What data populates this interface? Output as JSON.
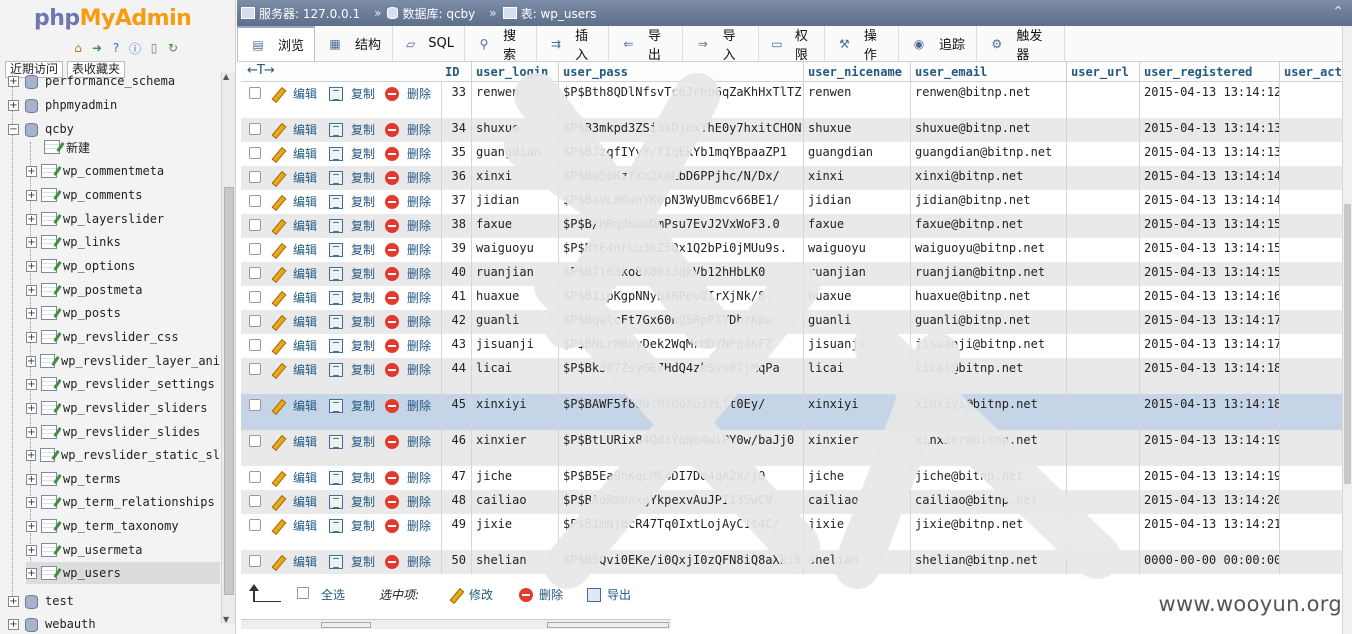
{
  "logo": {
    "part1": "php",
    "part2": "MyAdmin"
  },
  "nav": {
    "icons": [
      "home-icon",
      "exit-icon",
      "help-icon",
      "docs-icon",
      "settings-icon",
      "reload-icon"
    ],
    "tabs": [
      "近期访问",
      "表收藏夹"
    ],
    "tree": [
      {
        "label": "performance_schema",
        "type": "db",
        "expander": "+"
      },
      {
        "label": "phpmyadmin",
        "type": "db",
        "expander": "+"
      },
      {
        "label": "qcby",
        "type": "db",
        "expander": "−"
      },
      {
        "label": "新建",
        "type": "new",
        "expander": ""
      },
      {
        "label": "wp_commentmeta",
        "type": "table",
        "expander": "+"
      },
      {
        "label": "wp_comments",
        "type": "table",
        "expander": "+"
      },
      {
        "label": "wp_layerslider",
        "type": "table",
        "expander": "+"
      },
      {
        "label": "wp_links",
        "type": "table",
        "expander": "+"
      },
      {
        "label": "wp_options",
        "type": "table",
        "expander": "+"
      },
      {
        "label": "wp_postmeta",
        "type": "table",
        "expander": "+"
      },
      {
        "label": "wp_posts",
        "type": "table",
        "expander": "+"
      },
      {
        "label": "wp_revslider_css",
        "type": "table",
        "expander": "+"
      },
      {
        "label": "wp_revslider_layer_ani",
        "type": "table",
        "expander": "+"
      },
      {
        "label": "wp_revslider_settings",
        "type": "table",
        "expander": "+"
      },
      {
        "label": "wp_revslider_sliders",
        "type": "table",
        "expander": "+"
      },
      {
        "label": "wp_revslider_slides",
        "type": "table",
        "expander": "+"
      },
      {
        "label": "wp_revslider_static_sl",
        "type": "table",
        "expander": "+"
      },
      {
        "label": "wp_terms",
        "type": "table",
        "expander": "+"
      },
      {
        "label": "wp_term_relationships",
        "type": "table",
        "expander": "+"
      },
      {
        "label": "wp_term_taxonomy",
        "type": "table",
        "expander": "+"
      },
      {
        "label": "wp_usermeta",
        "type": "table",
        "expander": "+"
      },
      {
        "label": "wp_users",
        "type": "table",
        "expander": "+",
        "highlight": true
      },
      {
        "label": "test",
        "type": "db",
        "expander": "+"
      },
      {
        "label": "webauth",
        "type": "db",
        "expander": "+"
      }
    ]
  },
  "breadcrumb": {
    "server": "服务器: 127.0.0.1",
    "database": "数据库: qcby",
    "table": "表: wp_users"
  },
  "tabs": [
    {
      "label": "浏览",
      "icon": "browse-icon",
      "active": true
    },
    {
      "label": "结构",
      "icon": "structure-icon"
    },
    {
      "label": "SQL",
      "icon": "sql-icon"
    },
    {
      "label": "搜索",
      "icon": "search-icon"
    },
    {
      "label": "插入",
      "icon": "insert-icon"
    },
    {
      "label": "导出",
      "icon": "export-icon"
    },
    {
      "label": "导入",
      "icon": "import-icon"
    },
    {
      "label": "权限",
      "icon": "privileges-icon"
    },
    {
      "label": "操作",
      "icon": "operations-icon"
    },
    {
      "label": "追踪",
      "icon": "tracking-icon"
    },
    {
      "label": "触发器",
      "icon": "triggers-icon"
    }
  ],
  "grid": {
    "arrows": "←T→",
    "columns": [
      "ID",
      "user_login",
      "user_pass",
      "user_nicename",
      "user_email",
      "user_url",
      "user_registered",
      "user_acti"
    ],
    "actions": {
      "edit": "编辑",
      "copy": "复制",
      "delete": "删除"
    },
    "rows": [
      {
        "id": "33",
        "login": "renwen",
        "pass": "$P$Bth8QDlNfsvTc6Jrhp6qZaKhHxTlTZ1",
        "nicename": "renwen",
        "email": "renwen@bitnp.net",
        "url": "",
        "registered": "2015-04-13 13:14:12"
      },
      {
        "id": "34",
        "login": "shuxue",
        "pass": "$P$B3mkpd3ZSi3kDjoxYhE0y7hxitCHON1",
        "nicename": "shuxue",
        "email": "shuxue@bitnp.net",
        "url": "",
        "registered": "2015-04-13 13:14:13"
      },
      {
        "id": "35",
        "login": "guangdian",
        "pass": "$P$BJzqfIYyY/fIqEkYb1mqYBpaaZP1",
        "nicename": "guangdian",
        "email": "guangdian@bitnp.net",
        "url": "",
        "registered": "2015-04-13 13:14:13"
      },
      {
        "id": "36",
        "login": "xinxi",
        "pass": "$P$Bw5pKzfXn2XmLbD6PPjhc/N/Dx/",
        "nicename": "xinxi",
        "email": "xinxi@bitnp.net",
        "url": "",
        "registered": "2015-04-13 13:14:14"
      },
      {
        "id": "37",
        "login": "jidian",
        "pass": "$P$BaVLmKwnYK0pN3WyUBmcv66BE1/",
        "nicename": "jidian",
        "email": "jidian@bitnp.net",
        "url": "",
        "registered": "2015-04-13 13:14:14"
      },
      {
        "id": "38",
        "login": "faxue",
        "pass": "$P$B/HRqdxwaDmPsu7EvJ2VxWoF3.0",
        "nicename": "faxue",
        "email": "faxue@bitnp.net",
        "url": "",
        "registered": "2015-04-13 13:14:15"
      },
      {
        "id": "39",
        "login": "waiguoyu",
        "pass": "$P$BtE4nrLu3kZ5Qx1Q2bPi0jMUu9s.",
        "nicename": "waiguoyu",
        "email": "waiguoyu@bitnp.net",
        "url": "",
        "registered": "2015-04-13 13:14:15"
      },
      {
        "id": "40",
        "login": "ruanjian",
        "pass": "$P$B7163ko8X003JqkVb12hHbLK0",
        "nicename": "ruanjian",
        "email": "ruanjian@bitnp.net",
        "url": "",
        "registered": "2015-04-13 13:14:15"
      },
      {
        "id": "41",
        "login": "huaxue",
        "pass": "$P$B1ipKgpNNyb4RPevQIrXjNk/8.",
        "nicename": "huaxue",
        "email": "huaxue@bitnp.net",
        "url": "",
        "registered": "2015-04-13 13:14:16"
      },
      {
        "id": "42",
        "login": "guanli",
        "pass": "$P$BqwlcFt7Gx60nQ5RpPIYDhzKpw",
        "nicename": "guanli",
        "email": "guanli@bitnp.net",
        "url": "",
        "registered": "2015-04-13 13:14:17"
      },
      {
        "id": "43",
        "login": "jisuanji",
        "pass": "$P$BNLrMBnyDek2WqMrMDYNFq4KFZ",
        "nicename": "jisuanji",
        "email": "jisuanji@bitnp.net",
        "url": "",
        "registered": "2015-04-13 13:14:17"
      },
      {
        "id": "44",
        "login": "licai",
        "pass": "$P$Bk307ZsyGE7HdQ4zkSvv07jMqPa",
        "nicename": "licai",
        "email": "licai@bitnp.net",
        "url": "",
        "registered": "2015-04-13 13:14:18"
      },
      {
        "id": "45",
        "login": "xinxiyi",
        "pass": "$P$BAWF5f809.MfQpXo3zLft0Ey/",
        "nicename": "xinxiyi",
        "email": "xinxiyi@bitnp.net",
        "url": "",
        "registered": "2015-04-13 13:14:18"
      },
      {
        "id": "46",
        "login": "xinxier",
        "pass": "$P$BtLURix84Qd3YqNeAwiPY0w/baJj0",
        "nicename": "xinxier",
        "email": "xinxier@bitnp.net",
        "url": "",
        "registered": "2015-04-13 13:14:19"
      },
      {
        "id": "47",
        "login": "jiche",
        "pass": "$P$B5Ea9hKqLM64DI7Dd4qA2k/j0",
        "nicename": "jiche",
        "email": "jiche@bitnp.net",
        "url": "",
        "registered": "2015-04-13 13:14:19"
      },
      {
        "id": "48",
        "login": "cailiao",
        "pass": "$P$BAqRmVnxgYkpexvAuJPI135wCV.",
        "nicename": "cailiao",
        "email": "cailiao@bitnp.net",
        "url": "",
        "registered": "2015-04-13 13:14:20"
      },
      {
        "id": "49",
        "login": "jixie",
        "pass": "$P$B1mNjdcR47Tq0IxtLojAyC1t4C/",
        "nicename": "jixie",
        "email": "jixie@bitnp.net",
        "url": "",
        "registered": "2015-04-13 13:14:21"
      },
      {
        "id": "50",
        "login": "shelian",
        "pass": "$P$BSQvi0EKe/i0QxjI0zQFN8iQ8aXki0",
        "nicename": "shelian",
        "email": "shelian@bitnp.net",
        "url": "",
        "registered": "0000-00-00 00:00:00"
      }
    ]
  },
  "footer": {
    "check_all": "全选",
    "with_selected": "选中项:",
    "edit": "修改",
    "delete": "删除",
    "export": "导出"
  },
  "watermark": "www.wooyun.org",
  "colors": {
    "link": "#235a81",
    "crumb_bg": "#6d7d9a",
    "odd_row": "#e9e9e9",
    "selected_row": "#c5d5e7",
    "delete_icon": "#e23b2e"
  }
}
